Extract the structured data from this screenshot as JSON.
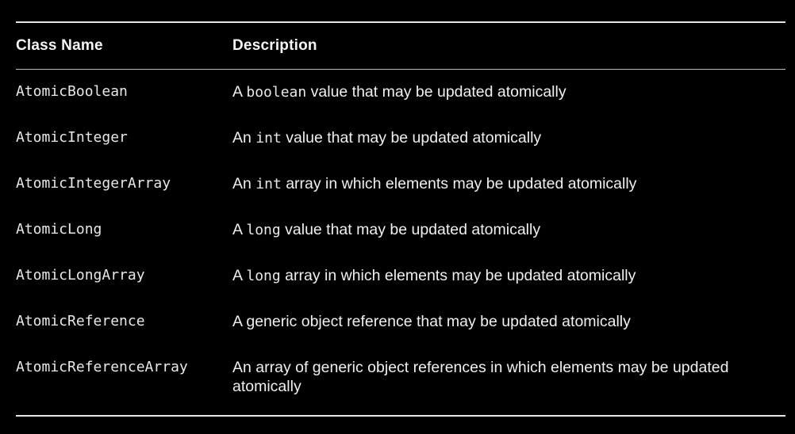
{
  "table": {
    "headers": {
      "class_name": "Class Name",
      "description": "Description"
    },
    "rows": [
      {
        "name": "AtomicBoolean",
        "pre": "A ",
        "code": "boolean",
        "post": " value that may be updated atomically"
      },
      {
        "name": "AtomicInteger",
        "pre": "An ",
        "code": "int",
        "post": " value that may be updated atomically"
      },
      {
        "name": "AtomicIntegerArray",
        "pre": "An ",
        "code": "int",
        "post": " array in which elements may be updated atomically"
      },
      {
        "name": "AtomicLong",
        "pre": "A ",
        "code": "long",
        "post": " value that may be updated atomically"
      },
      {
        "name": "AtomicLongArray",
        "pre": "A ",
        "code": "long",
        "post": " array in which elements may be updated atomically"
      },
      {
        "name": "AtomicReference",
        "pre": "A generic object reference that may be updated atomically",
        "code": "",
        "post": ""
      },
      {
        "name": "AtomicReferenceArray",
        "pre": "An array of generic object references in which elements may be updated atomically",
        "code": "",
        "post": ""
      }
    ]
  }
}
